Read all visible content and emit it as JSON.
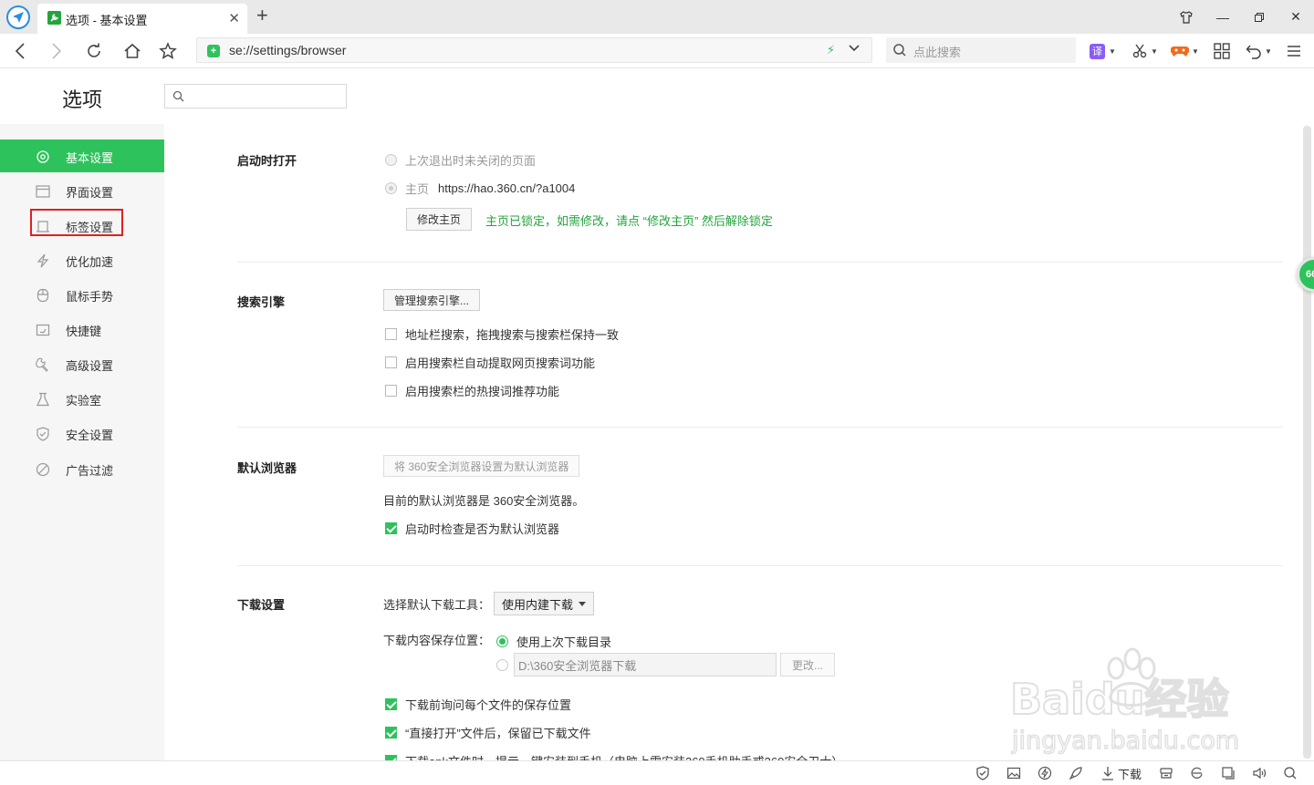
{
  "browser": {
    "tab_title": "选项 - 基本设置",
    "address": "se://settings/browser",
    "search_placeholder": "点此搜索",
    "translate_label": "译",
    "window_controls": [
      "shirt-icon",
      "minimize-icon",
      "restore-icon",
      "close-icon"
    ]
  },
  "page": {
    "title": "选项",
    "search_placeholder": ""
  },
  "sidebar": {
    "active_index": 0,
    "items": [
      {
        "label": "基本设置",
        "icon": "gear-icon"
      },
      {
        "label": "界面设置",
        "icon": "window-icon"
      },
      {
        "label": "标签设置",
        "icon": "tab-icon"
      },
      {
        "label": "优化加速",
        "icon": "bolt-icon"
      },
      {
        "label": "鼠标手势",
        "icon": "mouse-icon"
      },
      {
        "label": "快捷键",
        "icon": "keyboard-icon"
      },
      {
        "label": "高级设置",
        "icon": "wrench-icon"
      },
      {
        "label": "实验室",
        "icon": "flask-icon"
      },
      {
        "label": "安全设置",
        "icon": "shield-icon"
      },
      {
        "label": "广告过滤",
        "icon": "block-icon"
      }
    ]
  },
  "startup": {
    "label": "启动时打开",
    "opt_last": "上次退出时未关闭的页面",
    "opt_home": "主页",
    "home_url": "https://hao.360.cn/?a1004",
    "modify_button": "修改主页",
    "lock_note": "主页已锁定，如需修改，请点 “修改主页” 然后解除锁定"
  },
  "search_engine": {
    "label": "搜索引擎",
    "manage_button": "管理搜索引擎...",
    "options": [
      {
        "label": "地址栏搜索，拖拽搜索与搜索栏保持一致",
        "checked": false
      },
      {
        "label": "启用搜索栏自动提取网页搜索词功能",
        "checked": false
      },
      {
        "label": "启用搜索栏的热搜词推荐功能",
        "checked": false
      }
    ]
  },
  "default_browser": {
    "label": "默认浏览器",
    "set_button": "将 360安全浏览器设置为默认浏览器",
    "status": "目前的默认浏览器是 360安全浏览器。",
    "check_label": "启动时检查是否为默认浏览器",
    "check_checked": true
  },
  "download": {
    "label": "下载设置",
    "tool_label": "选择默认下载工具：",
    "tool_value": "使用内建下载",
    "location_label": "下载内容保存位置：",
    "use_last": "使用上次下载目录",
    "path_value": "D:\\360安全浏览器下载",
    "change_button": "更改...",
    "options": [
      {
        "label": "下载前询问每个文件的保存位置",
        "checked": true
      },
      {
        "label": "“直接打开”文件后，保留已下载文件",
        "checked": true
      },
      {
        "label": "下载apk文件时，提示一键安装到手机（电脑上需安装360手机助手或360安全卫士）",
        "checked": true
      }
    ]
  },
  "bubble_text": "66",
  "statusbar": {
    "download_label": "下载"
  },
  "watermark": {
    "brand": "Baidu经验",
    "url": "jingyan.baidu.com"
  },
  "colors": {
    "accent": "#2ec25c",
    "note_green": "#23a43d",
    "highlight_red": "#e02020"
  }
}
